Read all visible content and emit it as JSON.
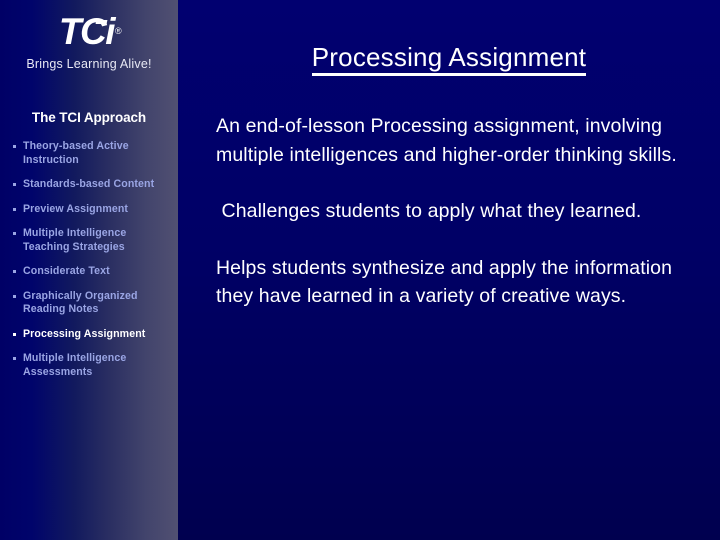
{
  "slide": {
    "title": "Processing Assignment",
    "background_color": "#000066",
    "accent_color": "#9aa5e4"
  },
  "logo": {
    "mark": "TCi",
    "registered_symbol": "®",
    "tagline": "Brings Learning Alive!"
  },
  "sidebar": {
    "title": "The TCI Approach",
    "items": [
      {
        "label": "Theory-based Active Instruction",
        "active": false
      },
      {
        "label": "Standards-based Content",
        "active": false
      },
      {
        "label": "Preview Assignment",
        "active": false
      },
      {
        "label": "Multiple Intelligence Teaching Strategies",
        "active": false
      },
      {
        "label": "Considerate Text",
        "active": false
      },
      {
        "label": "Graphically Organized Reading Notes",
        "active": false
      },
      {
        "label": "Processing Assignment",
        "active": true
      },
      {
        "label": "Multiple Intelligence Assessments",
        "active": false
      }
    ]
  },
  "body": {
    "paragraphs": [
      "An end-of-lesson Processing assignment, involving multiple intelligences and higher-order thinking skills.",
      " Challenges students to apply what they learned.",
      "Helps students synthesize and apply the information they have learned in a variety of creative ways."
    ]
  }
}
